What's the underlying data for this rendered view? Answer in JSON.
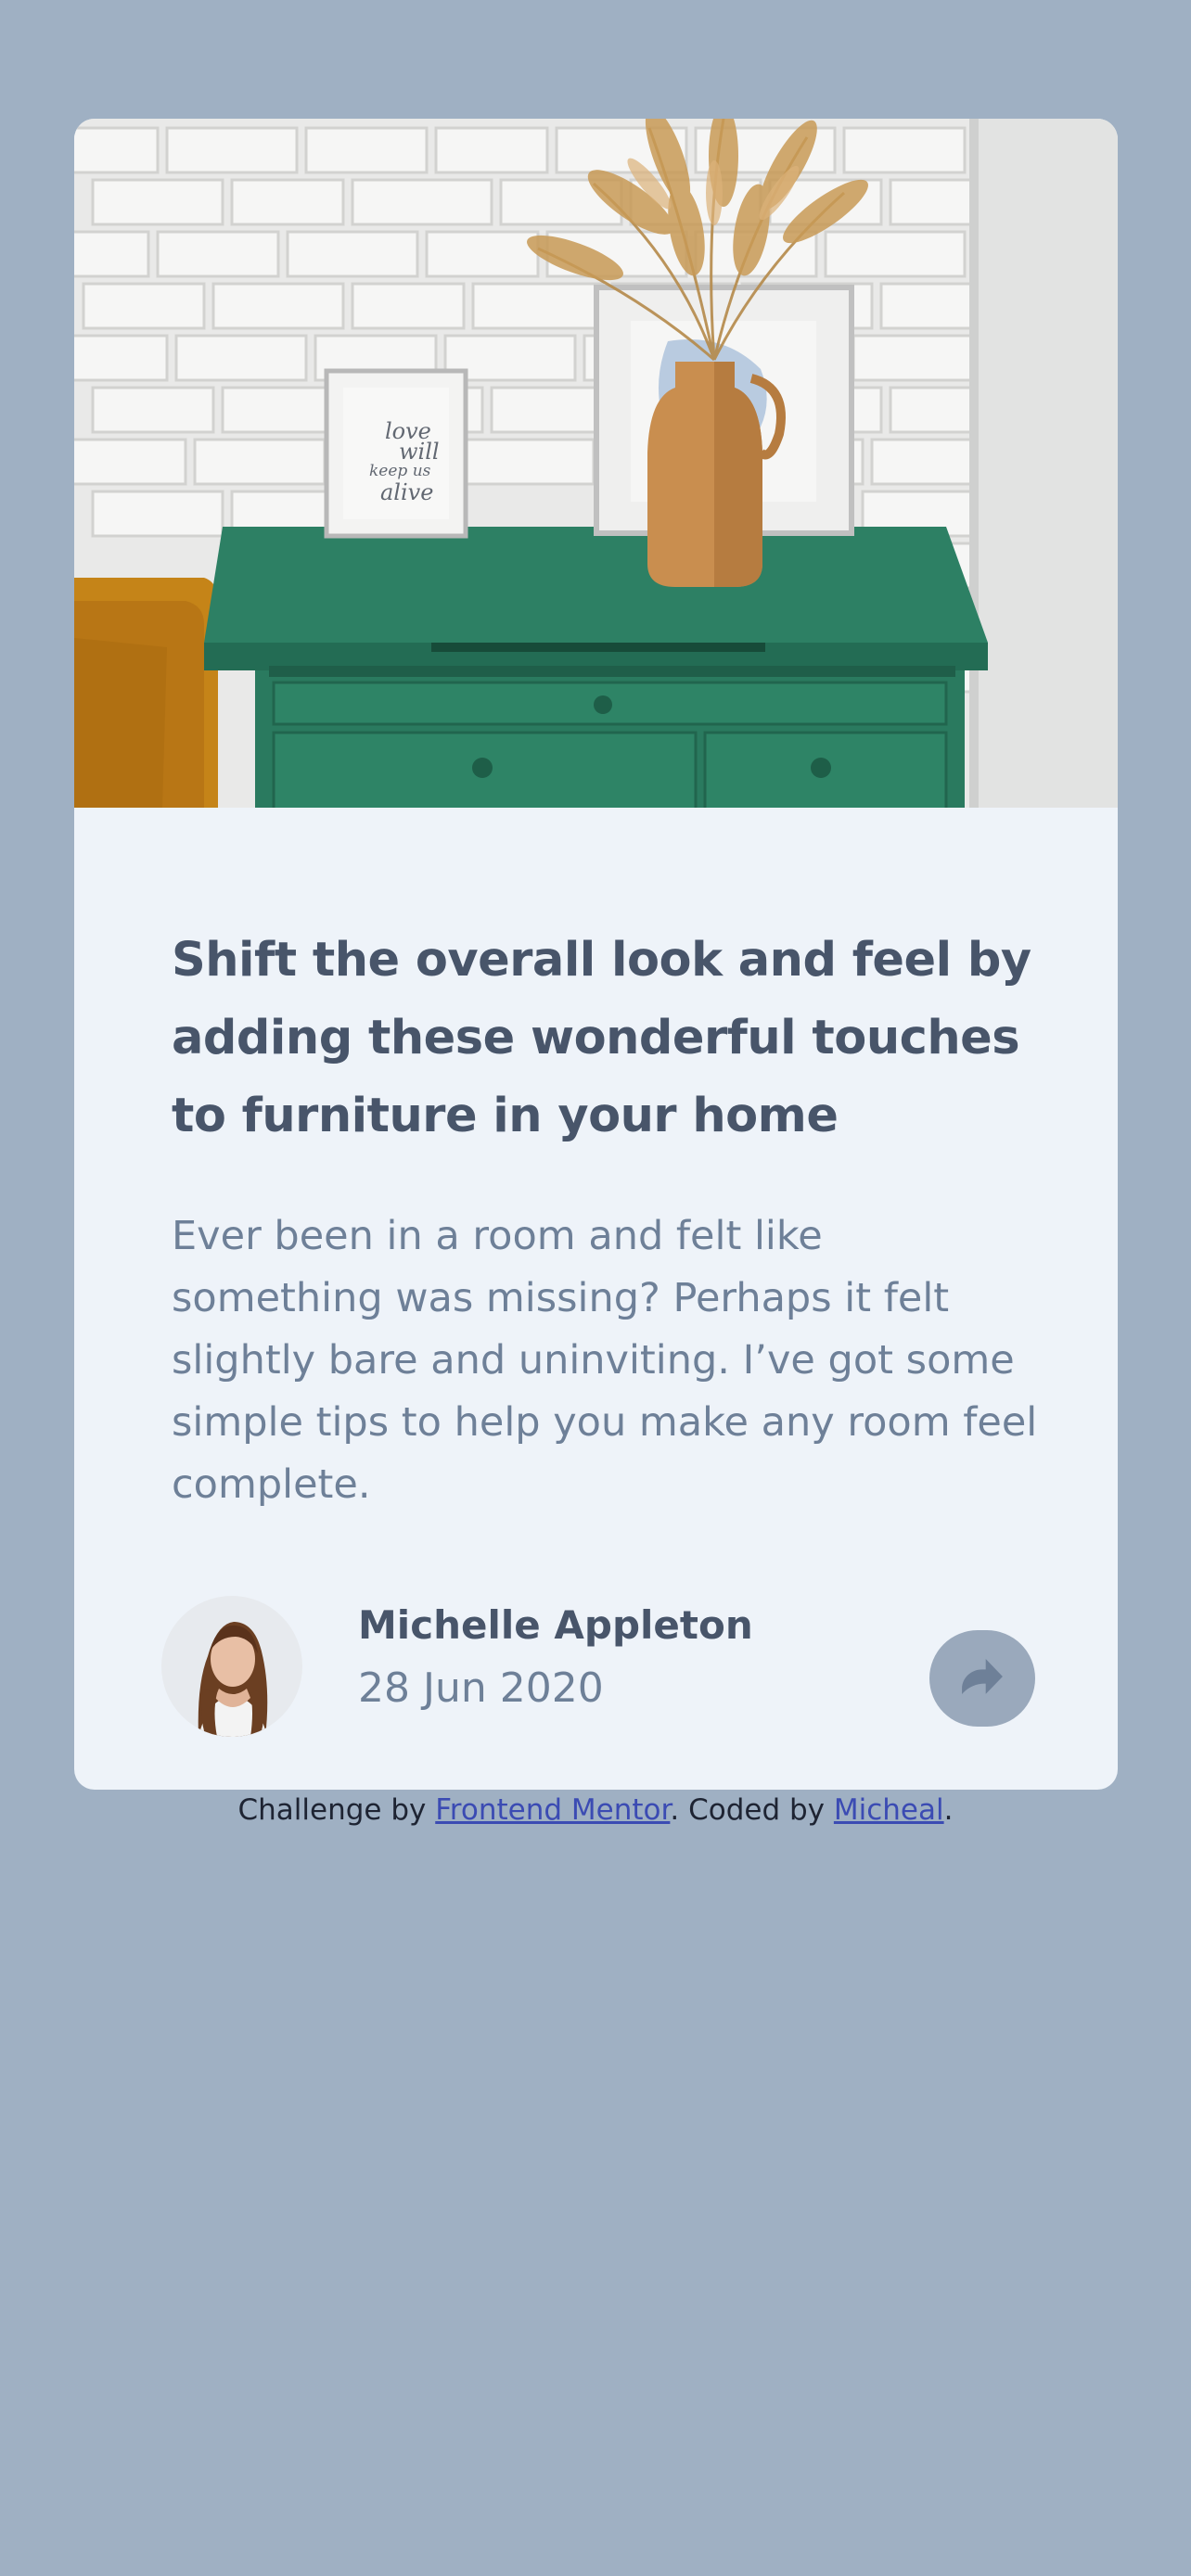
{
  "colors": {
    "page_background": "#9fb0c3",
    "card_background": "#eef3f9",
    "title_text": "#48556a",
    "body_text": "#6e8098",
    "share_button": "#9aa9bc",
    "link": "#3b4bb3"
  },
  "article": {
    "hero_image": "furniture-drawers-image",
    "title": "Shift the overall look and feel by adding these wonderful touches to furniture in your home",
    "excerpt": "Ever been in a room and felt like something was missing? Perhaps it felt slightly bare and uninviting. I’ve got some simple tips to help you make any room feel complete.",
    "frame_text": "love will keep us alive"
  },
  "author": {
    "avatar": "avatar-michelle",
    "name": "Michelle Appleton",
    "date": "28 Jun 2020"
  },
  "share": {
    "icon": "share-icon"
  },
  "attribution": {
    "prefix": "Challenge by ",
    "link1": "Frontend Mentor",
    "middle": ". Coded by ",
    "link2": "Micheal",
    "suffix": "."
  }
}
